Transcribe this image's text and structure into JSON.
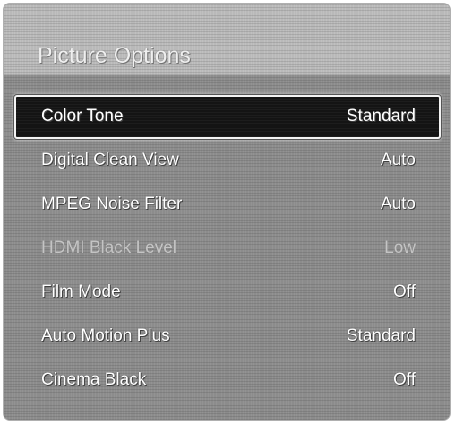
{
  "menu": {
    "title": "Picture Options",
    "items": [
      {
        "label": "Color Tone",
        "value": "Standard",
        "selected": true,
        "enabled": true
      },
      {
        "label": "Digital Clean View",
        "value": "Auto",
        "selected": false,
        "enabled": true
      },
      {
        "label": "MPEG Noise Filter",
        "value": "Auto",
        "selected": false,
        "enabled": true
      },
      {
        "label": "HDMI Black Level",
        "value": "Low",
        "selected": false,
        "enabled": false
      },
      {
        "label": "Film Mode",
        "value": "Off",
        "selected": false,
        "enabled": true
      },
      {
        "label": "Auto Motion Plus",
        "value": "Standard",
        "selected": false,
        "enabled": true
      },
      {
        "label": "Cinema Black",
        "value": "Off",
        "selected": false,
        "enabled": true
      }
    ]
  },
  "colors": {
    "panel_background": "#8c8c8c",
    "header_background": "#b9b9b9",
    "selected_background": "#141414",
    "selected_border": "#f3f3f3",
    "text": "#ffffff",
    "disabled_text": "#c4c4c4"
  }
}
